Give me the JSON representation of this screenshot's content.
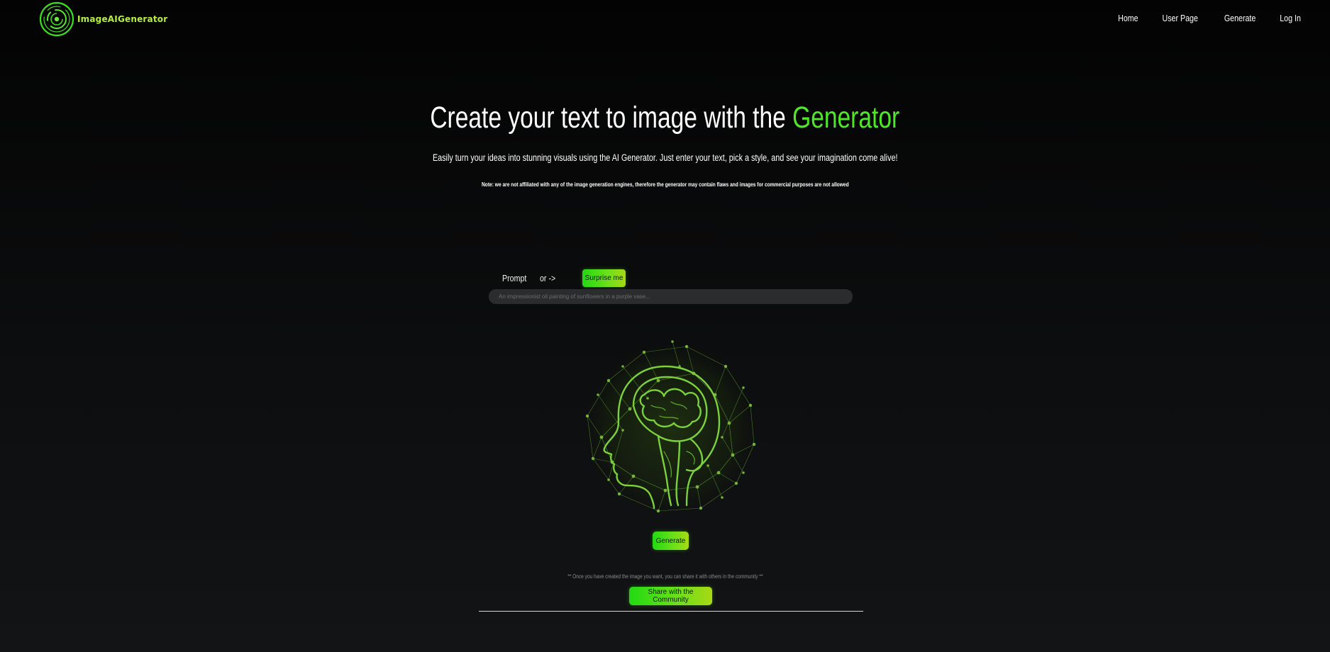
{
  "header": {
    "logo_text": "ImageAIGenerator",
    "nav": [
      {
        "label": "Home"
      },
      {
        "label": "User Page"
      },
      {
        "label": "Generate"
      },
      {
        "label": "Log In"
      }
    ]
  },
  "hero": {
    "title_prefix": "Create your text to image with the ",
    "title_accent": "Generator",
    "subtitle": "Easily turn your ideas into stunning visuals using the AI Generator. Just enter your text, pick a style, and see your imagination come alive!",
    "note": "Note: we are not affiliated with any of the image generation engines, therefore the generator may contain flaws and images for commercial purposes are not allowed"
  },
  "prompt": {
    "label": "Prompt",
    "or_label": "or ->",
    "surprise_label": "Surprise me",
    "placeholder": "An impressionist oil painting of sunflowers in a purple vase...",
    "value": ""
  },
  "actions": {
    "generate_label": "Generate",
    "share_note": "** Once you have created the image you want, you can share it with others in the community **",
    "share_label": "Share with the Community"
  },
  "colors": {
    "accent": "#4de826",
    "logo": "#b8f03c",
    "background": "#0b0c0d"
  },
  "icons": {
    "logo": "concentric-circles-logo-icon",
    "preview": "brain-network-sphere-image"
  }
}
